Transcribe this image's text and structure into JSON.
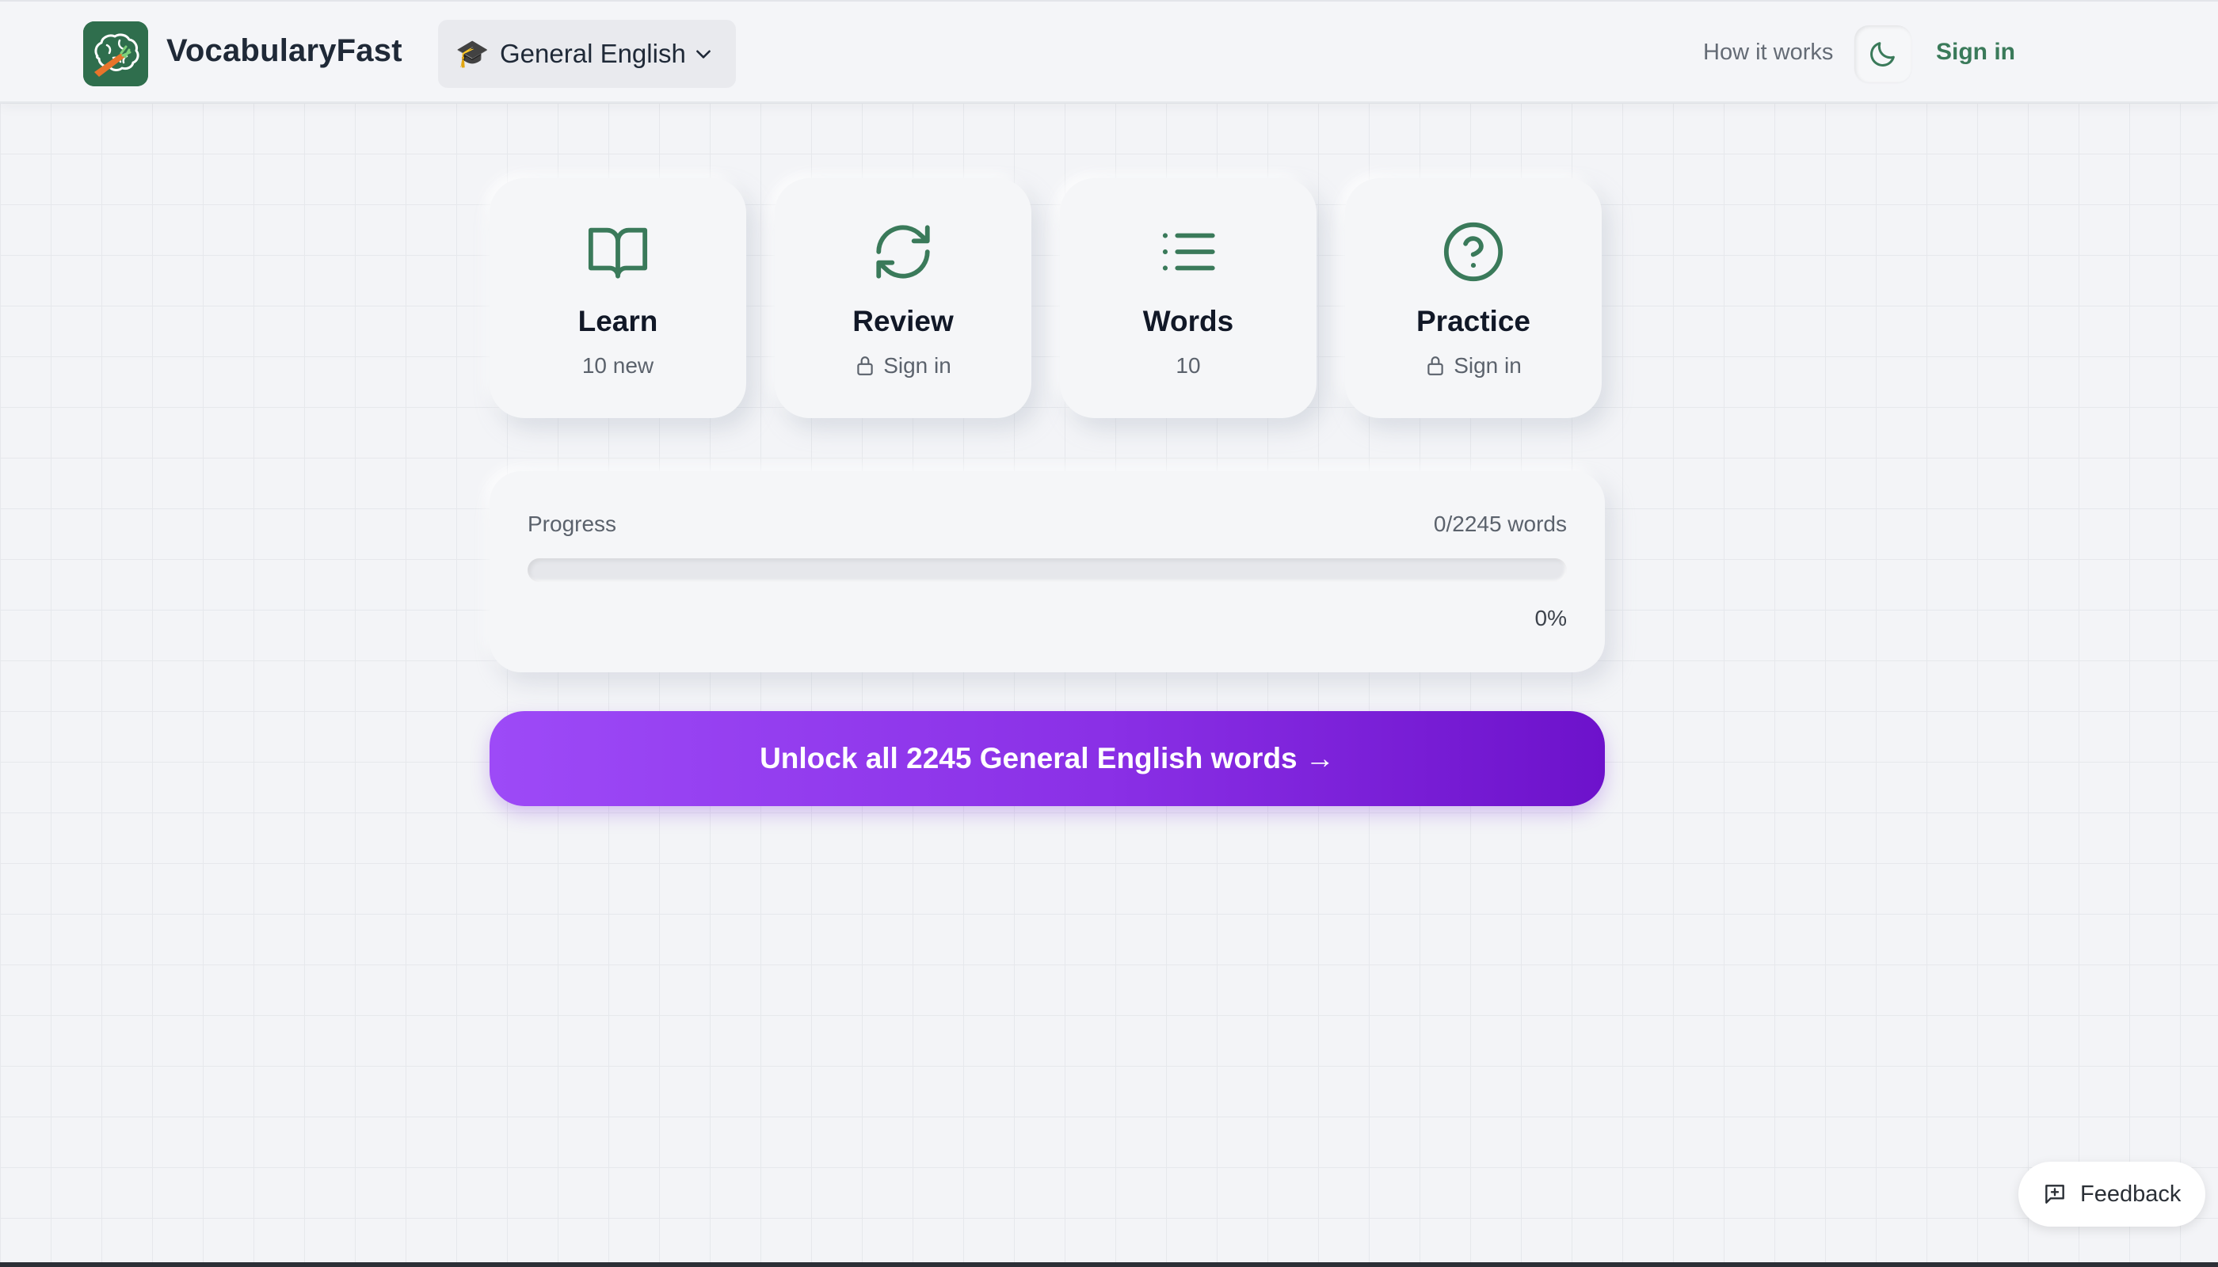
{
  "app": {
    "brand": "VocabularyFast",
    "accent_color": "#3a7a5a",
    "logo_icon": "brain-carrot-logo"
  },
  "header": {
    "language": {
      "flag_icon": "graduation-cap-icon",
      "flag_glyph": "🎓",
      "label": "General English"
    },
    "how_it_works": "How it works",
    "theme_icon": "moon-icon",
    "sign_in": "Sign in"
  },
  "cards": [
    {
      "title": "Learn",
      "subtitle": "10 new",
      "icon": "book-open-icon",
      "locked": false
    },
    {
      "title": "Review",
      "subtitle": "Sign in",
      "icon": "refresh-icon",
      "locked": true
    },
    {
      "title": "Words",
      "subtitle": "10",
      "icon": "list-icon",
      "locked": false
    },
    {
      "title": "Practice",
      "subtitle": "Sign in",
      "icon": "help-circle-icon",
      "locked": true
    }
  ],
  "progress": {
    "label": "Progress",
    "count": "0/2245 words",
    "percent_text": "0%",
    "fraction": 0
  },
  "unlock_button": {
    "label": "Unlock all 2245 General English words →",
    "gradient_start": "#9d4af7",
    "gradient_end": "#6d12cb"
  },
  "feedback": {
    "label": "Feedback",
    "icon": "message-plus-icon"
  }
}
